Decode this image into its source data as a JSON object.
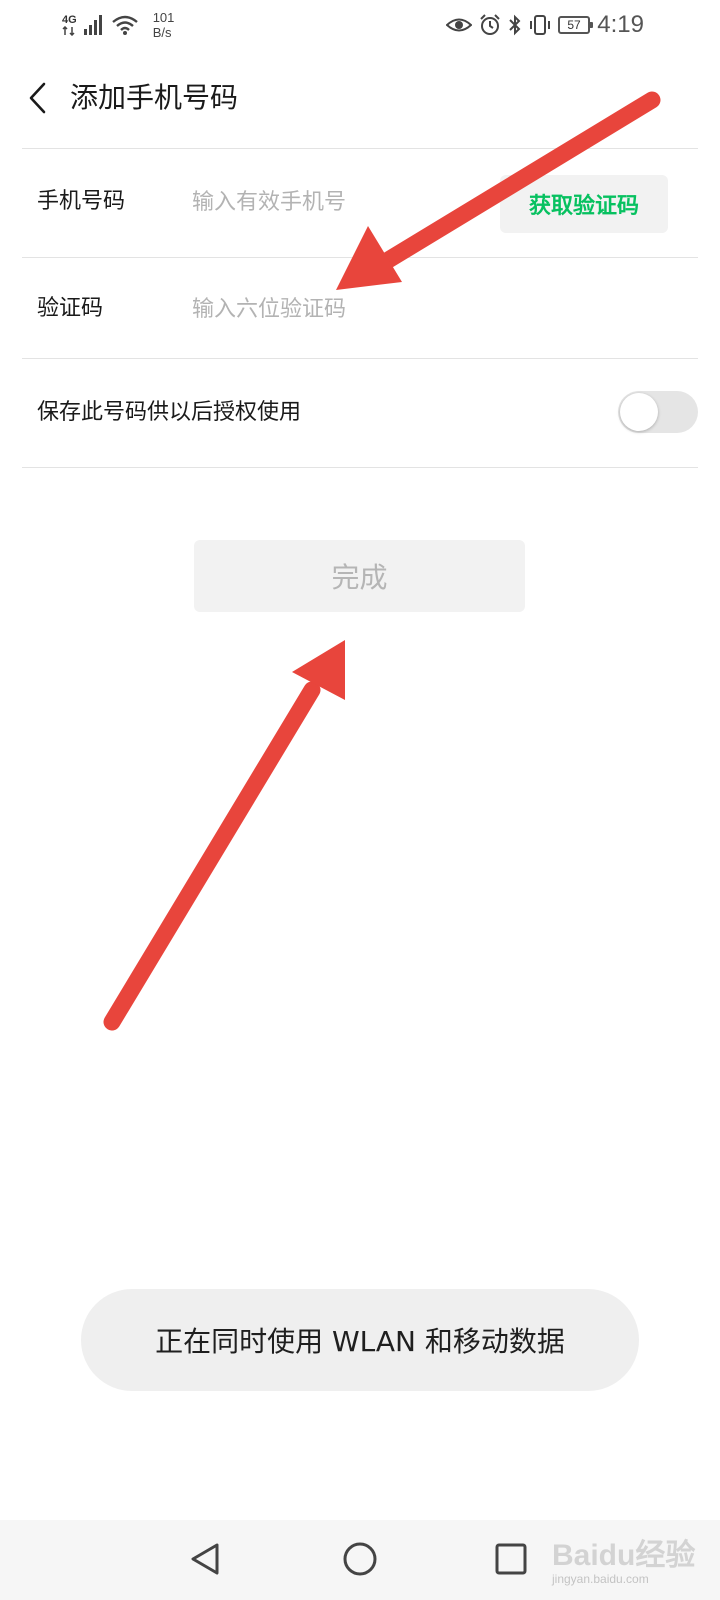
{
  "status_bar": {
    "network_type": "4G",
    "speed_value": "101",
    "speed_unit": "B/s",
    "icons": [
      "signal-icon",
      "wifi-icon",
      "eye-icon",
      "alarm-icon",
      "bluetooth-icon",
      "vibrate-icon",
      "battery-icon"
    ],
    "battery_level": "57",
    "time": "4:19"
  },
  "header": {
    "back_icon": "chevron-left-icon",
    "title": "添加手机号码"
  },
  "form": {
    "phone": {
      "label": "手机号码",
      "value": "",
      "placeholder": "输入有效手机号",
      "code_button": "获取验证码"
    },
    "code": {
      "label": "验证码",
      "value": "",
      "placeholder": "输入六位验证码"
    },
    "save": {
      "label": "保存此号码供以后授权使用",
      "enabled": false
    }
  },
  "done_button": "完成",
  "toast": "正在同时使用 WLAN 和移动数据",
  "nav_bar": {
    "icons": [
      "back-triangle-icon",
      "home-circle-icon",
      "recents-square-icon"
    ]
  },
  "watermark": {
    "brand": "Baidu经验",
    "url": "jingyan.baidu.com"
  },
  "colors": {
    "accent_green": "#07c160",
    "annotation_red": "#e8453c",
    "disabled_text": "#b5b5b5",
    "placeholder": "#b3b3b3"
  }
}
